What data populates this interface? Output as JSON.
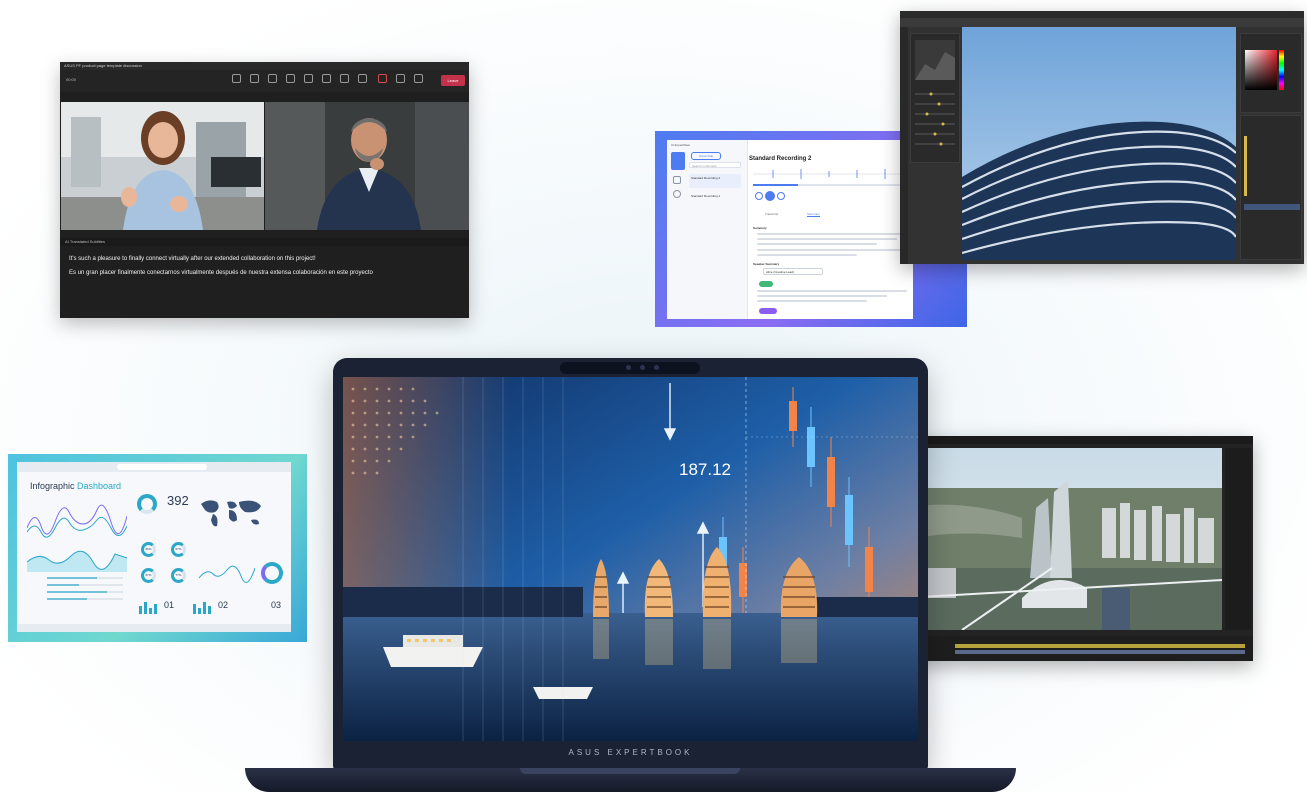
{
  "laptop": {
    "brand_label": "ASUS EXPERTBOOK",
    "chart_readout": "187.12"
  },
  "teams": {
    "window_title": "ASUS PF product page template discussion",
    "meeting_time": "00:00",
    "leave_label": "Leave",
    "captions_header": "AI Translated Subtitles",
    "caption_en": "It's such a pleasure to finally connect virtually after our extended collaboration on this project!",
    "caption_es": "Es un gran placer finalmente conectarnos virtualmente después de nuestra extensa colaboración en este proyecto"
  },
  "recorder": {
    "app_name": "AI ExpertMeet",
    "import_label": "Import File",
    "search_placeholder": "Search in Records",
    "recording_title": "Standard Recording 2",
    "list_items": [
      "Standard Recording 2",
      "Standard Recording 1"
    ],
    "tabs": [
      "Transcript",
      "Summary"
    ],
    "summary_heading": "Summary",
    "speaker_heading": "Speaker Summary",
    "speaker_select": "Alice (Creative Lead)"
  },
  "dashboard": {
    "title_part1": "Infographic",
    "title_part2": " Dashboard",
    "big_value": "392",
    "rings": [
      "86%",
      "67%",
      "67%",
      "77%"
    ],
    "step_numbers": [
      "01",
      "02",
      "03"
    ]
  },
  "colors": {
    "teams_leave": "#c4314b",
    "recorder_accent": "#4d7cf0",
    "dashboard_accent": "#2ba7c8"
  }
}
